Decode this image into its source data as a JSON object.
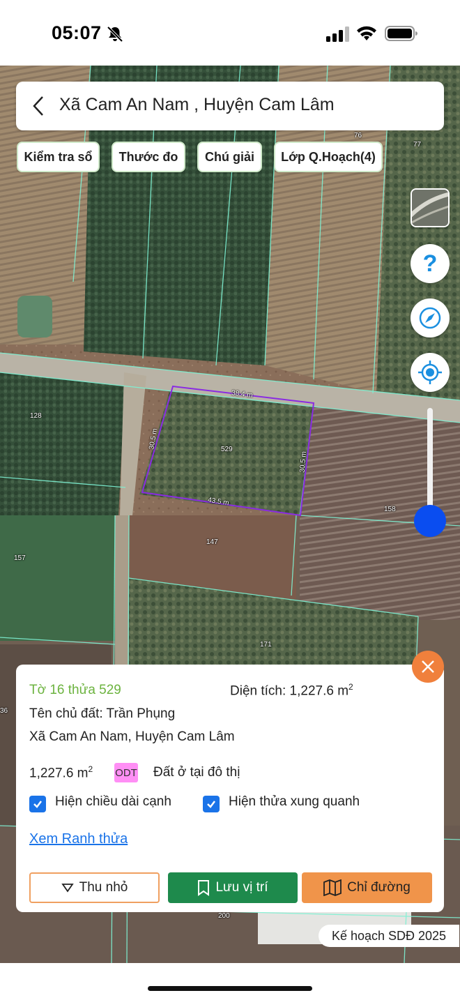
{
  "status_bar": {
    "time": "05:07"
  },
  "header": {
    "title": "Xã Cam An Nam , Huyện Cam Lâm"
  },
  "chips": [
    {
      "label": "Kiểm tra sổ"
    },
    {
      "label": "Thước đo"
    },
    {
      "label": "Chú giải"
    },
    {
      "label": "Lớp Q.Hoạch(4)"
    }
  ],
  "map": {
    "parcel_numbers": [
      "76",
      "77",
      "128",
      "529",
      "158",
      "147",
      "157",
      "171",
      "200",
      "36"
    ],
    "edge_lengths": [
      "38.4 m",
      "30.5 m",
      "30.5 m",
      "43.5 m"
    ],
    "highlight_color": "#8a2be2",
    "boundary_color": "#7ef2d4"
  },
  "info": {
    "parcel_title": "Tờ 16 thửa 529",
    "area_label": "Diện tích: 1,227.6 m",
    "area_sup": "2",
    "owner": "Tên chủ đất: Trần Phụng",
    "address": "Xã Cam An Nam, Huyện Cam Lâm",
    "area_value": "1,227.6 m",
    "area_value_sup": "2",
    "land_code": "ODT",
    "land_code_color": "#ff8ff5",
    "land_desc": "Đất ở tại đô thị",
    "checkbox_edges": "Hiện chiều dài cạnh",
    "checkbox_neighbors": "Hiện thửa xung quanh",
    "boundary_link": "Xem Ranh thửa",
    "btn_collapse": "Thu nhỏ",
    "btn_save": "Lưu vị trí",
    "btn_directions": "Chỉ đường"
  },
  "plan_label": "Kế hoạch SDĐ 2025",
  "colors": {
    "accent_green": "#1e8a4c",
    "accent_orange": "#f0944a",
    "slider_blue": "#0a4df0",
    "title_green": "#6cb33f"
  }
}
